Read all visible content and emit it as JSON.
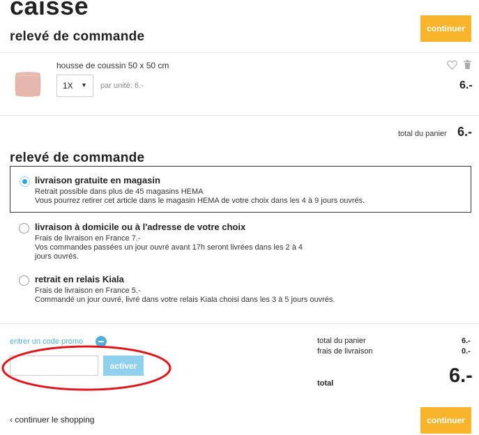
{
  "header": {
    "title": "caisse",
    "subtitle": "relevé de commande",
    "continue_label": "continuer"
  },
  "cart": {
    "item": {
      "name": "housse de coussin 50 x 50 cm",
      "qty": "1X",
      "unit_price": "par unité: 6.-",
      "price": "6.-"
    },
    "total_label": "total du panier",
    "total_value": "6.-"
  },
  "delivery": {
    "heading": "relevé de commande",
    "options": [
      {
        "title": "livraison gratuite en magasin",
        "line1": "Retrait possible dans plus de 45 magasins HEMA",
        "line2": "Vous pourrez retirer cet article dans le magasin HEMA de votre choix dans les 4 à 9 jours ouvrés.",
        "selected": true
      },
      {
        "title": "livraison à domicile ou à l'adresse de votre choix",
        "line1": "Frais de livraison en France 7.-",
        "line2": "Vos commandes passées un jour ouvré avant 17h seront livrées dans les 2 à 4",
        "line3": "jours ouvrés.",
        "selected": false
      },
      {
        "title": "retrait en relais Kiala",
        "line1": "Frais de livraison en France 5.-",
        "line2": "Commandé un jour ouvré, livré dans votre relais Kiala choisi dans les 3 à 5 jours ouvrés.",
        "selected": false
      }
    ]
  },
  "promo": {
    "label": "entrer un code promo",
    "input_value": "",
    "button": "activer"
  },
  "summary": {
    "cart_total_label": "total du panier",
    "cart_total_value": "6.-",
    "delivery_label": "frais de livraison",
    "delivery_value": "0.-",
    "total_label": "total",
    "total_value": "6.-"
  },
  "footer": {
    "continue_shopping": "continuer le shopping",
    "continue_label": "continuer"
  },
  "colors": {
    "accent": "#f8b42b",
    "link": "#4fb0dd",
    "annotation": "#e0161b"
  }
}
